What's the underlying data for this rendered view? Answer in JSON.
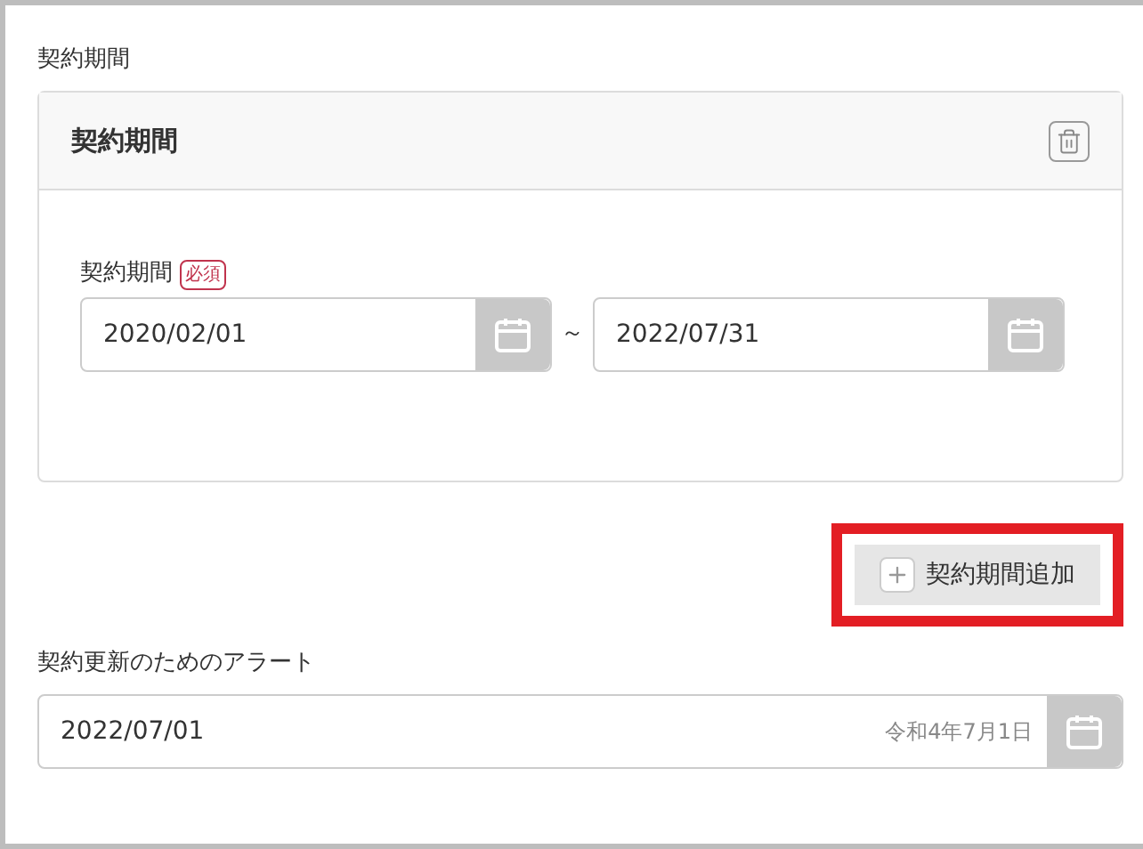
{
  "section_label": "契約期間",
  "card": {
    "title": "契約期間",
    "field": {
      "label": "契約期間",
      "required_badge": "必須",
      "start": {
        "value": "2020/02/01"
      },
      "separator": "～",
      "end": {
        "value": "2022/07/31"
      }
    }
  },
  "add_button": {
    "label": "契約期間追加",
    "highlighted": true
  },
  "alert": {
    "label": "契約更新のためのアラート",
    "value": "2022/07/01",
    "era_date": "令和4年7月1日"
  }
}
